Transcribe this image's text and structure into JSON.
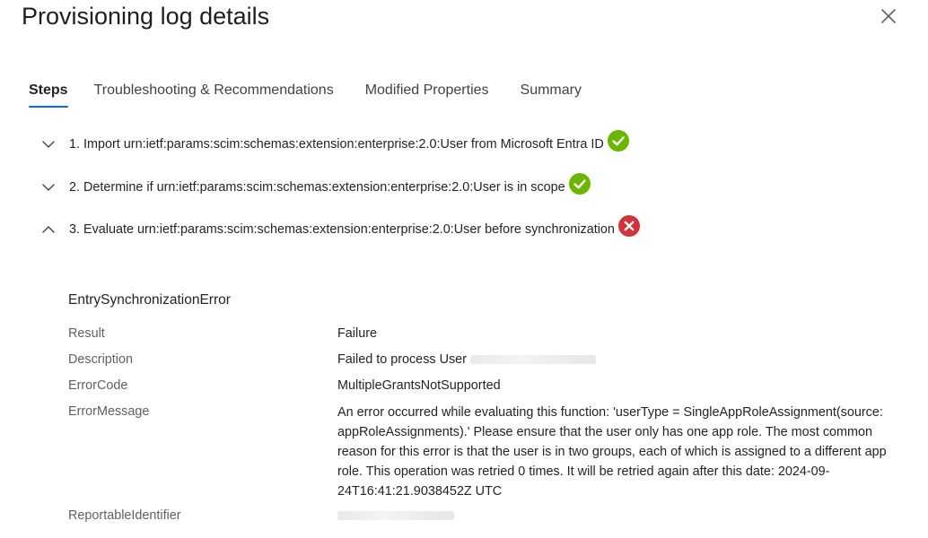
{
  "header": {
    "title": "Provisioning log details"
  },
  "tabs": [
    {
      "label": "Steps",
      "active": true
    },
    {
      "label": "Troubleshooting & Recommendations",
      "active": false
    },
    {
      "label": "Modified Properties",
      "active": false
    },
    {
      "label": "Summary",
      "active": false
    }
  ],
  "steps": [
    {
      "text": "1. Import urn:ietf:params:scim:schemas:extension:enterprise:2.0:User from Microsoft Entra ID",
      "status": "success",
      "expanded": false
    },
    {
      "text": "2. Determine if urn:ietf:params:scim:schemas:extension:enterprise:2.0:User is in scope",
      "status": "success",
      "expanded": false
    },
    {
      "text": "3. Evaluate urn:ietf:params:scim:schemas:extension:enterprise:2.0:User before synchronization",
      "status": "error",
      "expanded": true
    }
  ],
  "details": {
    "section_title": "EntrySynchronizationError",
    "result_label": "Result",
    "result_value": "Failure",
    "description_label": "Description",
    "description_value": "Failed to process User",
    "errorcode_label": "ErrorCode",
    "errorcode_value": "MultipleGrantsNotSupported",
    "errormessage_label": "ErrorMessage",
    "errormessage_value": "An error occurred while evaluating this function: 'userType = SingleAppRoleAssignment(source: appRoleAssignments).' Please ensure that the user only has one app role. The most common reason for this error is that the user is in two groups, each of which is assigned to a different app role. This operation was retried 0 times. It will be retried again after this date: 2024-09-24T16:41:21.9038452Z UTC",
    "reportable_label": "ReportableIdentifier"
  },
  "colors": {
    "success": "#6bb700",
    "error": "#d13438",
    "tab_underline": "#0f6cbd"
  },
  "icons": {
    "close": "close-icon",
    "collapse": "chevron-down-icon",
    "expand": "chevron-up-icon",
    "success": "checkmark-circle-icon",
    "error": "dismiss-circle-icon"
  }
}
